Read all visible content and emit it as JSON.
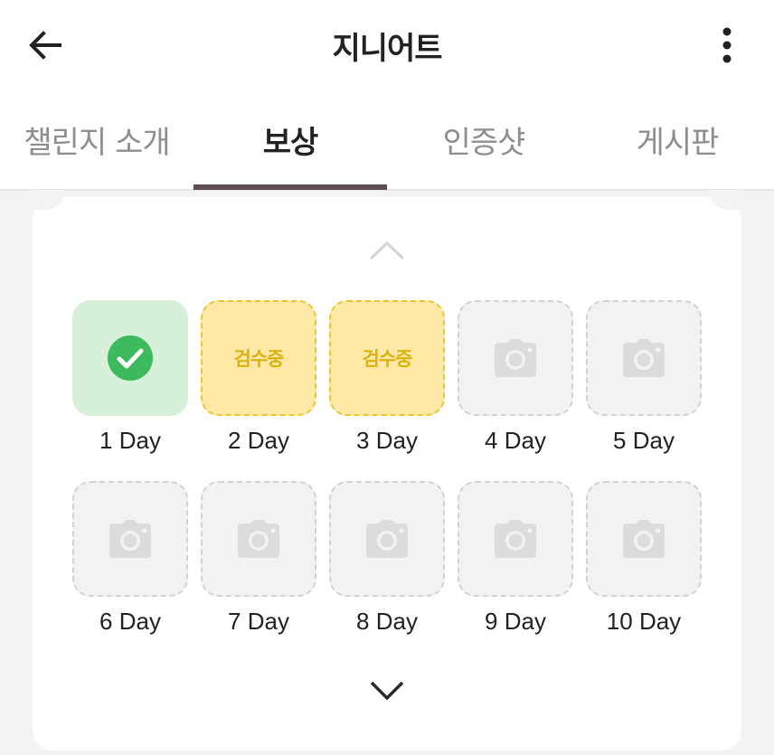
{
  "header": {
    "title": "지니어트"
  },
  "tabs": [
    {
      "label": "챌린지 소개"
    },
    {
      "label": "보상"
    },
    {
      "label": "인증샷"
    },
    {
      "label": "게시판"
    }
  ],
  "active_tab": "보상",
  "days": [
    {
      "label": "1 Day",
      "status": "done",
      "icon": "check-circle-icon"
    },
    {
      "label": "2 Day",
      "status": "pending",
      "text": "검수중"
    },
    {
      "label": "3 Day",
      "status": "pending",
      "text": "검수중"
    },
    {
      "label": "4 Day",
      "status": "empty",
      "icon": "camera-icon"
    },
    {
      "label": "5 Day",
      "status": "empty",
      "icon": "camera-icon"
    },
    {
      "label": "6 Day",
      "status": "empty",
      "icon": "camera-icon"
    },
    {
      "label": "7 Day",
      "status": "empty",
      "icon": "camera-icon"
    },
    {
      "label": "8 Day",
      "status": "empty",
      "icon": "camera-icon"
    },
    {
      "label": "9 Day",
      "status": "empty",
      "icon": "camera-icon"
    },
    {
      "label": "10 Day",
      "status": "empty",
      "icon": "camera-icon"
    }
  ],
  "colors": {
    "accent": "#5d4d52",
    "done_bg": "#d7f0d9",
    "done_check": "#3dba5e",
    "pending_bg": "#fde9a5",
    "pending_text": "#d9b314",
    "empty_bg": "#f2f2f2"
  }
}
